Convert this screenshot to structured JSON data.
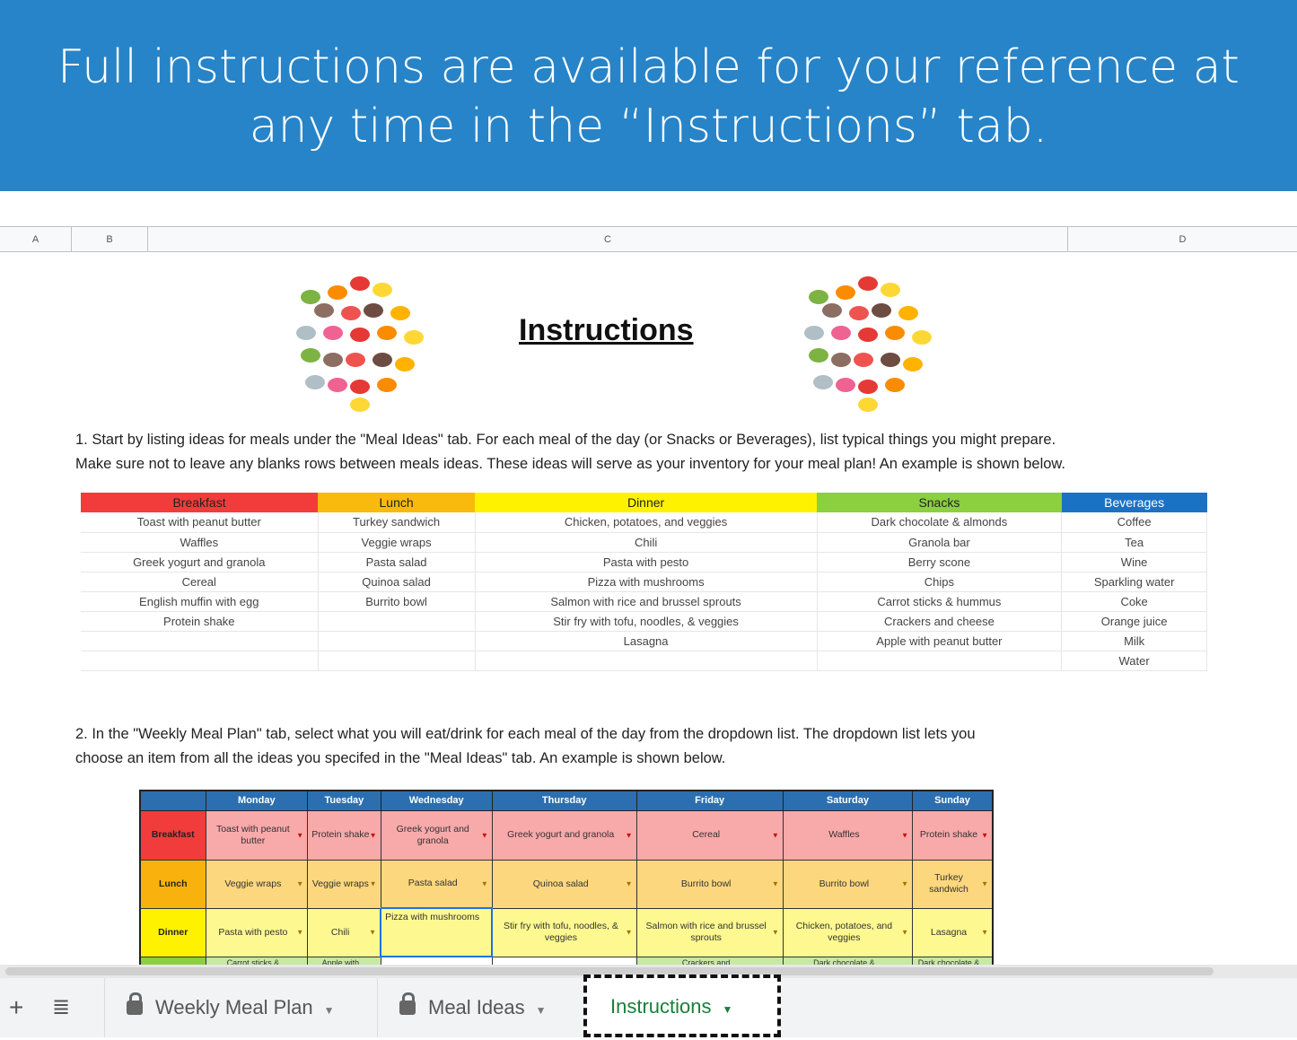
{
  "banner": {
    "line1": "Full instructions are available for your reference at",
    "line2": "any time in the “Instructions” tab."
  },
  "columns": [
    "A",
    "B",
    "C",
    "D"
  ],
  "title": "Instructions",
  "step1": {
    "line1": "1. Start by listing ideas for meals under the \"Meal Ideas\" tab. For each meal of the day (or Snacks or Beverages), list typical things you might prepare.",
    "line2": "Make sure not to leave any blanks rows between meals ideas. These ideas will serve as your inventory for your meal plan! An example is shown below."
  },
  "meal_ideas": {
    "headers": [
      "Breakfast",
      "Lunch",
      "Dinner",
      "Snacks",
      "Beverages"
    ],
    "header_colors": [
      "#f23c3c",
      "#f9b90d",
      "#fef200",
      "#8ccf3f",
      "#1b72c4"
    ],
    "rows": [
      [
        "Toast with peanut butter",
        "Turkey sandwich",
        "Chicken, potatoes, and veggies",
        "Dark chocolate & almonds",
        "Coffee"
      ],
      [
        "Waffles",
        "Veggie wraps",
        "Chili",
        "Granola bar",
        "Tea"
      ],
      [
        "Greek yogurt and granola",
        "Pasta salad",
        "Pasta with pesto",
        "Berry scone",
        "Wine"
      ],
      [
        "Cereal",
        "Quinoa salad",
        "Pizza with mushrooms",
        "Chips",
        "Sparkling water"
      ],
      [
        "English muffin with egg",
        "Burrito bowl",
        "Salmon with rice and brussel sprouts",
        "Carrot sticks & hummus",
        "Coke"
      ],
      [
        "Protein shake",
        "",
        "Stir fry with tofu, noodles, & veggies",
        "Crackers and cheese",
        "Orange juice"
      ],
      [
        "",
        "",
        "Lasagna",
        "Apple with peanut butter",
        "Milk"
      ],
      [
        "",
        "",
        "",
        "",
        "Water"
      ]
    ]
  },
  "step2": {
    "line1": "2. In the \"Weekly Meal Plan\" tab, select what you will eat/drink for each meal of the day from the dropdown list. The dropdown list lets you",
    "line2": "choose an item from all the ideas you specifed in the \"Meal Ideas\" tab. An example is shown below."
  },
  "weekly": {
    "days": [
      "Monday",
      "Tuesday",
      "Wednesday",
      "Thursday",
      "Friday",
      "Saturday",
      "Sunday"
    ],
    "rows": [
      {
        "label": "Breakfast",
        "label_color": "#f23c3c",
        "cell_color": "#f8a9a9",
        "cells": [
          "Toast with peanut butter",
          "Protein shake",
          "Greek yogurt and granola",
          "Greek yogurt and granola",
          "Cereal",
          "Waffles",
          "Protein shake"
        ]
      },
      {
        "label": "Lunch",
        "label_color": "#f9b20d",
        "cell_color": "#fcd77e",
        "cells": [
          "Veggie wraps",
          "Veggie wraps",
          "Pasta salad",
          "Quinoa salad",
          "Burrito bowl",
          "Burrito bowl",
          "Turkey sandwich"
        ]
      },
      {
        "label": "Dinner",
        "label_color": "#fef200",
        "cell_color": "#fdf990",
        "cells": [
          "Pasta with pesto",
          "Chili",
          "Pizza with mushrooms",
          "Stir fry with tofu, noodles, & veggies",
          "Salmon with rice and brussel sprouts",
          "Chicken, potatoes, and veggies",
          "Lasagna"
        ]
      },
      {
        "label": "",
        "label_color": "#8ccf3f",
        "cell_color": "#c6e9a4",
        "cells": [
          "Carrot sticks &",
          "Apple with peanut",
          "",
          "",
          "Crackers and",
          "Dark chocolate &",
          "Dark chocolate &"
        ]
      }
    ]
  },
  "tabs": {
    "add_icon": "plus-icon",
    "list_icon": "list-icon",
    "items": [
      {
        "label": "Weekly Meal Plan",
        "locked": true
      },
      {
        "label": "Meal Ideas",
        "locked": true
      },
      {
        "label": "Instructions",
        "active": true,
        "color": "#188038"
      }
    ]
  }
}
